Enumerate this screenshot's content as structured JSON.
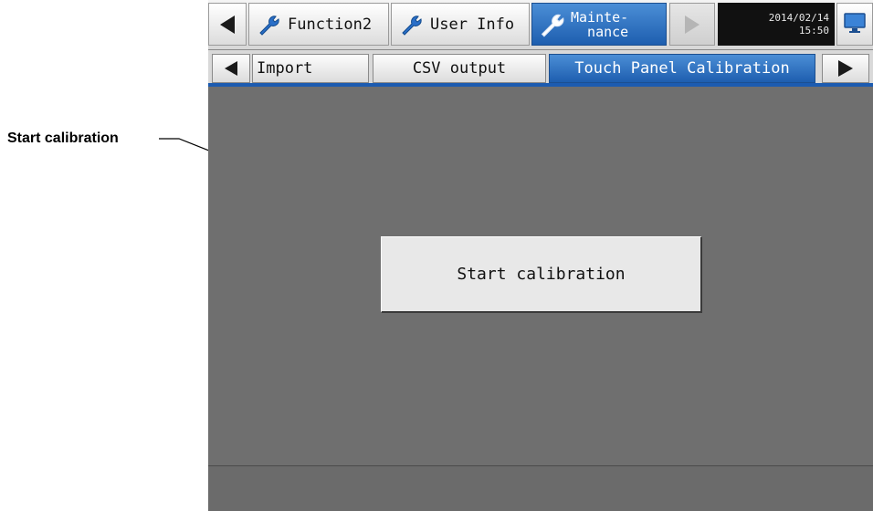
{
  "annotation": {
    "label": "Start calibration"
  },
  "top_tabs": {
    "function2": "Function2",
    "user_info": "User Info",
    "maintenance": "Mainte-\n  nance"
  },
  "clock": {
    "date": "2014/02/14",
    "time": "15:50"
  },
  "sub_tabs": {
    "import": "Import",
    "csv_output": "CSV output",
    "touch_panel_calibration": "Touch Panel Calibration"
  },
  "main": {
    "start_calibration_button": "Start calibration"
  },
  "colors": {
    "active_tab": "#2f74c4",
    "background": "#6f6f6f",
    "button": "#e8e8e8"
  },
  "icons": [
    "left-arrow-icon",
    "wrench-icon",
    "right-arrow-icon",
    "monitor-icon"
  ]
}
